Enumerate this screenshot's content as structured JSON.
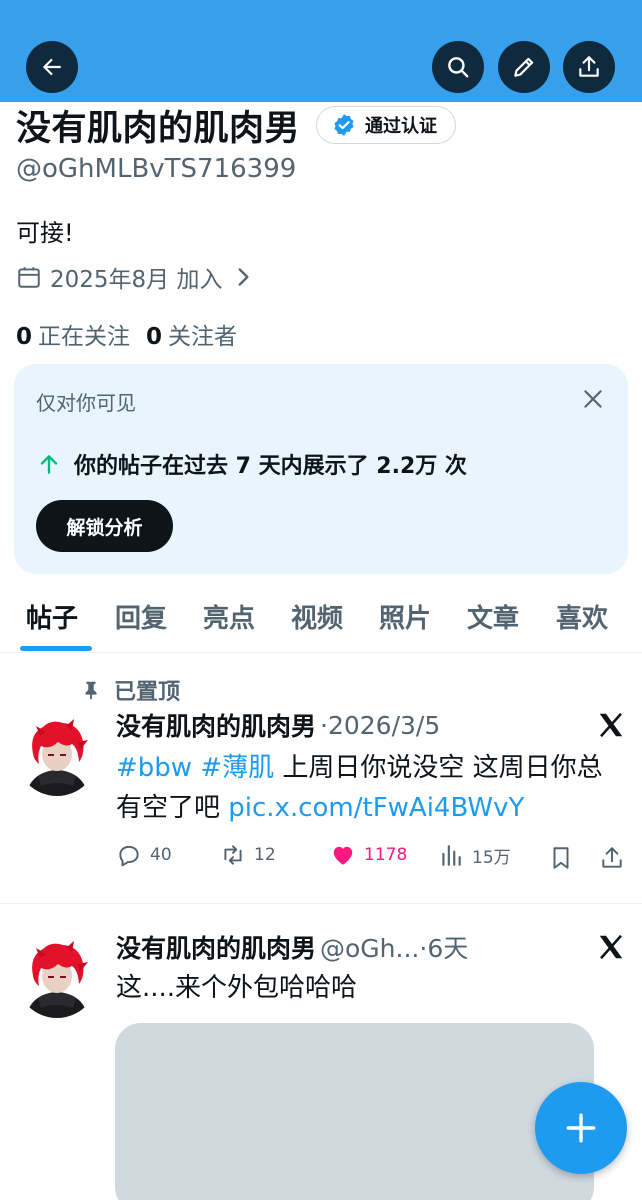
{
  "header": {
    "back_icon": "arrow-left-icon",
    "search_icon": "search-icon",
    "edit_icon": "pencil-icon",
    "share_icon": "share-icon",
    "banner_color": "#36a0ec"
  },
  "profile": {
    "name": "没有肌肉的肌肉男",
    "verified_label": "通过认证",
    "handle": "@oGhMLBvTS716399",
    "bio": "可接!",
    "joined": "2025年8月 加入",
    "following_count": "0",
    "following_label": "正在关注",
    "followers_count": "0",
    "followers_label": "关注者"
  },
  "private_card": {
    "title": "仅对你可见",
    "stat": "你的帖子在过去 7 天内展示了 2.2万 次",
    "button": "解锁分析",
    "bg_color": "#e8f5fd"
  },
  "tabs": [
    {
      "label": "帖子",
      "active": true
    },
    {
      "label": "回复",
      "active": false
    },
    {
      "label": "亮点",
      "active": false
    },
    {
      "label": "视频",
      "active": false
    },
    {
      "label": "照片",
      "active": false
    },
    {
      "label": "文章",
      "active": false
    },
    {
      "label": "喜欢",
      "active": false
    }
  ],
  "posts": [
    {
      "pinned_label": "已置顶",
      "author": "没有肌肉的肌肉男",
      "meta": "·2026/3/5",
      "text_links": "#bbw #薄肌",
      "text_plain": " 上周日你说没空 这周日你总有空了吧 ",
      "text_url": "pic.x.com/tFwAi4BWvY",
      "replies": "40",
      "reposts": "12",
      "likes": "1178",
      "views": "15万"
    },
    {
      "author": "没有肌肉的肌肉男",
      "meta": "@oGh...·6天",
      "text": "这....来个外包哈哈哈"
    }
  ],
  "accent_color": "#1d9bf0",
  "like_color": "#f91880",
  "fab_icon": "plus-icon"
}
